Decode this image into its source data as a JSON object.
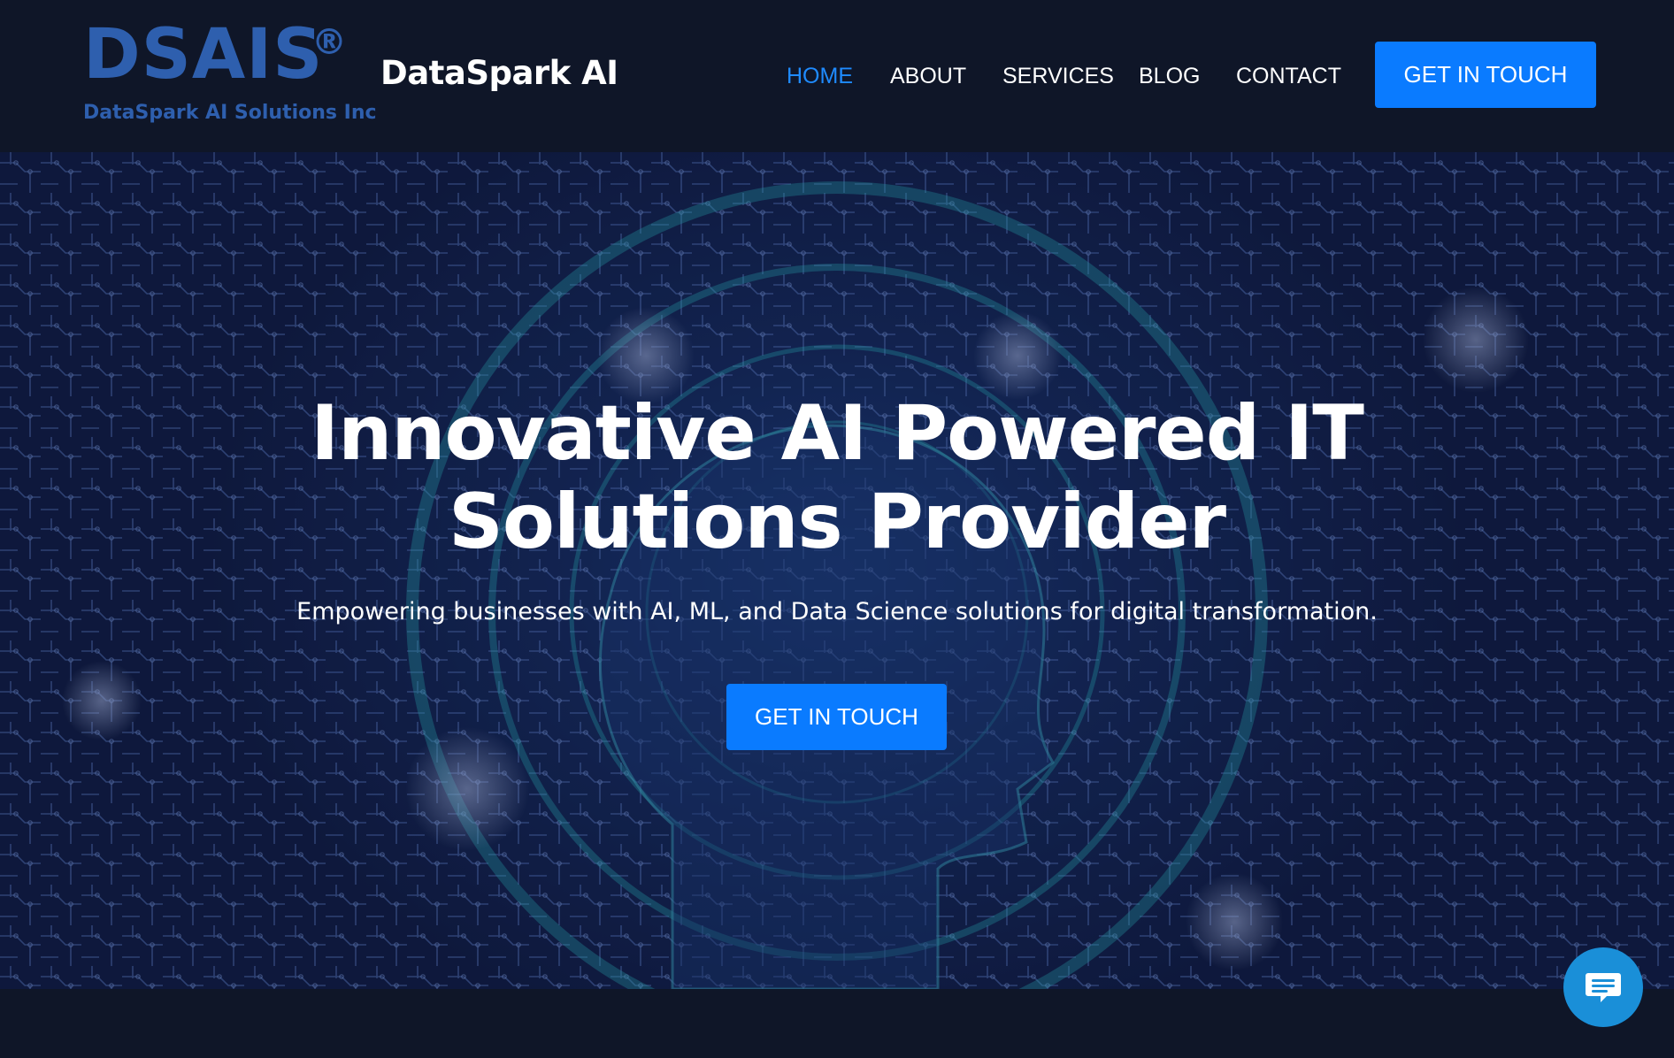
{
  "header": {
    "logo": {
      "mark": "DSAIS",
      "registered": "®",
      "subtitle": "DataSpark AI Solutions Inc"
    },
    "brand": "DataSpark AI",
    "nav": [
      {
        "label": "HOME",
        "active": true
      },
      {
        "label": "ABOUT",
        "active": false
      },
      {
        "label": "SERVICES",
        "active": false
      },
      {
        "label": "BLOG",
        "active": false
      },
      {
        "label": "CONTACT",
        "active": false
      }
    ],
    "cta_label": "GET IN TOUCH"
  },
  "hero": {
    "title_line1": "Innovative AI Powered IT",
    "title_line2": "Solutions Provider",
    "subtitle": "Empowering businesses with AI, ML, and Data Science solutions for digital transformation.",
    "cta_label": "GET IN TOUCH",
    "background": "circuit-brain-image"
  },
  "chat": {
    "icon": "chat-icon"
  },
  "colors": {
    "page_bg": "#0f1628",
    "accent": "#0a7bff",
    "nav_active": "#1f8bff",
    "logo": "#2e5fae",
    "chat": "#1a8fd8"
  }
}
